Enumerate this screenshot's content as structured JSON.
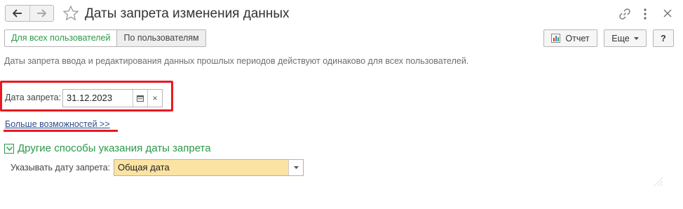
{
  "window": {
    "title": "Даты запрета изменения данных"
  },
  "tabs": [
    {
      "label": "Для всех пользователей",
      "active": true
    },
    {
      "label": "По пользователям",
      "active": false
    }
  ],
  "toolbar": {
    "report_label": "Отчет",
    "more_label": "Еще",
    "help_label": "?"
  },
  "description": "Даты запрета ввода и редактирования данных прошлых периодов действуют одинаково для всех пользователей.",
  "date_field": {
    "label": "Дата запрета:",
    "value": "31.12.2023",
    "calendar_icon": "calendar-icon",
    "clear_label": "×"
  },
  "more_link": "Больше возможностей >>",
  "group": {
    "title": "Другие способы указания даты запрета",
    "expanded": true,
    "mode_label": "Указывать дату запрета:",
    "mode_value": "Общая дата"
  },
  "colors": {
    "accent_green": "#2b9a4a",
    "highlight_red": "#e8191f",
    "link_blue": "#2f4d8d",
    "select_yellow": "#fbe3a3"
  }
}
